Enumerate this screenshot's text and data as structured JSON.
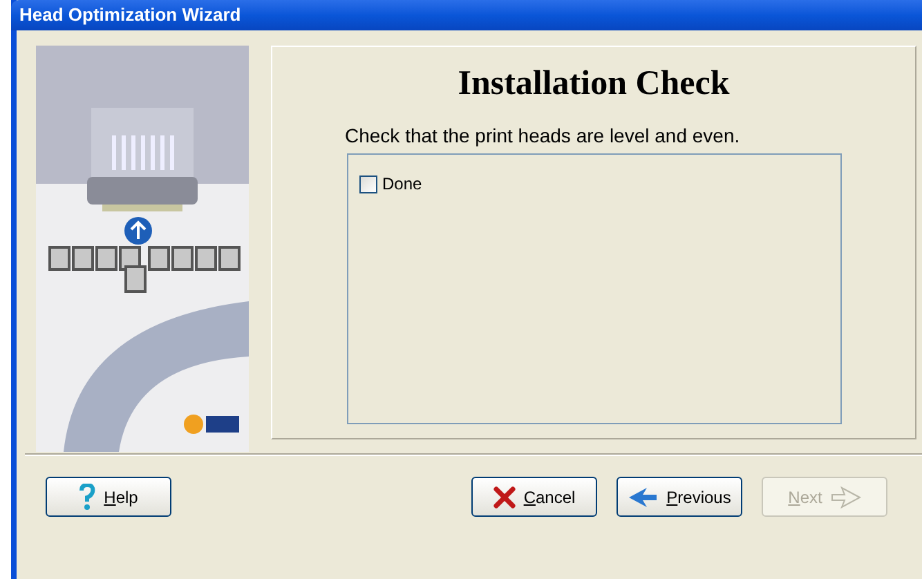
{
  "window": {
    "title": "Head Optimization Wizard"
  },
  "page": {
    "heading": "Installation Check",
    "instruction": "Check that the print heads are level and even."
  },
  "checkboxes": [
    {
      "label": "Done",
      "checked": false
    }
  ],
  "buttons": [
    {
      "kind": "help",
      "label": "Help",
      "disabled": false
    },
    {
      "kind": "cancel",
      "label": "Cancel",
      "disabled": false
    },
    {
      "kind": "previous",
      "label": "Previous",
      "disabled": false
    },
    {
      "kind": "next",
      "label": "Next",
      "disabled": true
    }
  ]
}
